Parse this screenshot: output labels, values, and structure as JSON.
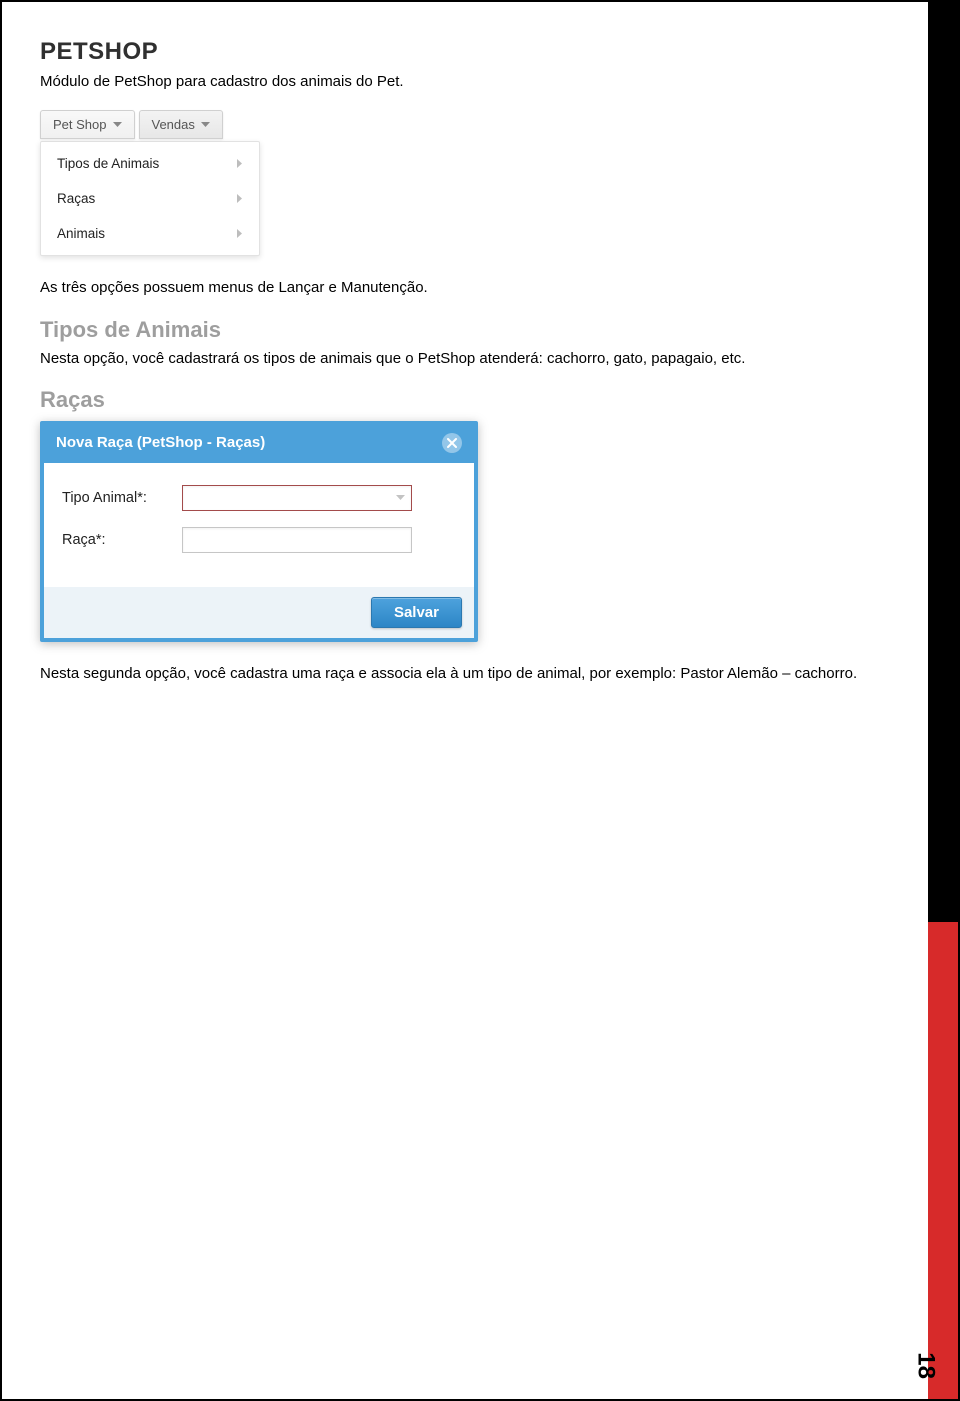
{
  "heading": "PETSHOP",
  "intro": "Módulo de PetShop para cadastro dos animais do Pet.",
  "tabs": {
    "petshop": "Pet Shop",
    "vendas": "Vendas"
  },
  "dropdown": {
    "items": [
      {
        "label": "Tipos de Animais"
      },
      {
        "label": "Raças"
      },
      {
        "label": "Animais"
      }
    ]
  },
  "para_options": "As três opções possuem menus de Lançar e Manutenção.",
  "sub_tipos": "Tipos de Animais",
  "para_tipos": "Nesta opção, você cadastrará os tipos de animais que o PetShop atenderá: cachorro, gato, papagaio, etc.",
  "sub_racas": "Raças",
  "dialog": {
    "title": "Nova Raça (PetShop - Raças)",
    "field_tipo_label": "Tipo Animal*:",
    "field_raca_label": "Raça*:",
    "save": "Salvar"
  },
  "para_racas": "Nesta segunda opção, você cadastra uma raça e associa ela à um tipo de animal, por exemplo: Pastor Alemão – cachorro.",
  "page_number": "18"
}
